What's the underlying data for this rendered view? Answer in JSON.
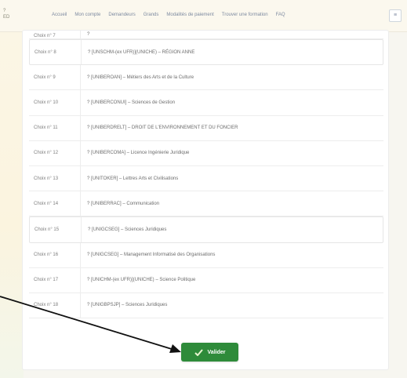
{
  "header": {
    "logo_lines": [
      "?",
      "ED"
    ],
    "nav": [
      "Accueil",
      "Mon compte",
      "Demandeurs",
      "Grands",
      "Modalités de paiement",
      "Trouver une formation",
      "FAQ"
    ],
    "menu_btn": "≡"
  },
  "rows": [
    {
      "label": "Choix n° 7",
      "value": "?"
    },
    {
      "label": "Choix n° 8",
      "value": "? [UNSCHM-(ex UFR)](UNICHE) – RÉGION ANNE"
    },
    {
      "label": "Choix n° 9",
      "value": "? [UNIBEROAN] – Métiers des Arts et de la Culture"
    },
    {
      "label": "Choix n° 10",
      "value": "? [UNIBERCONUI] – Sciences de Gestion"
    },
    {
      "label": "Choix n° 11",
      "value": "? [UNIBERDRELT] – DROIT DE L'ENVIRONNEMENT ET DU FONCIER"
    },
    {
      "label": "Choix n° 12",
      "value": "? [UNIBERCOMA] – Licence Ingénierie Juridique"
    },
    {
      "label": "Choix n° 13",
      "value": "? [UNITOKER] – Lettres Arts et Civilisations"
    },
    {
      "label": "Choix n° 14",
      "value": "? [UNIBERRAC] – Communication"
    },
    {
      "label": "Choix n° 15",
      "value": "? [UNIGCSEG] – Sciences Juridiques"
    },
    {
      "label": "Choix n° 16",
      "value": "? [UNIGCSEG] – Management Informatisé des Organisations"
    },
    {
      "label": "Choix n° 17",
      "value": "? [UNICHM-(ex UFR)](UNICHE) – Science Politique"
    },
    {
      "label": "Choix n° 18",
      "value": "? [UNIGBPSJP] – Sciences Juridiques"
    }
  ],
  "validate_button": {
    "label": "Valider",
    "icon": "check-icon"
  },
  "colors": {
    "button": "#2e8b3a",
    "background": "#f7f6f0"
  }
}
